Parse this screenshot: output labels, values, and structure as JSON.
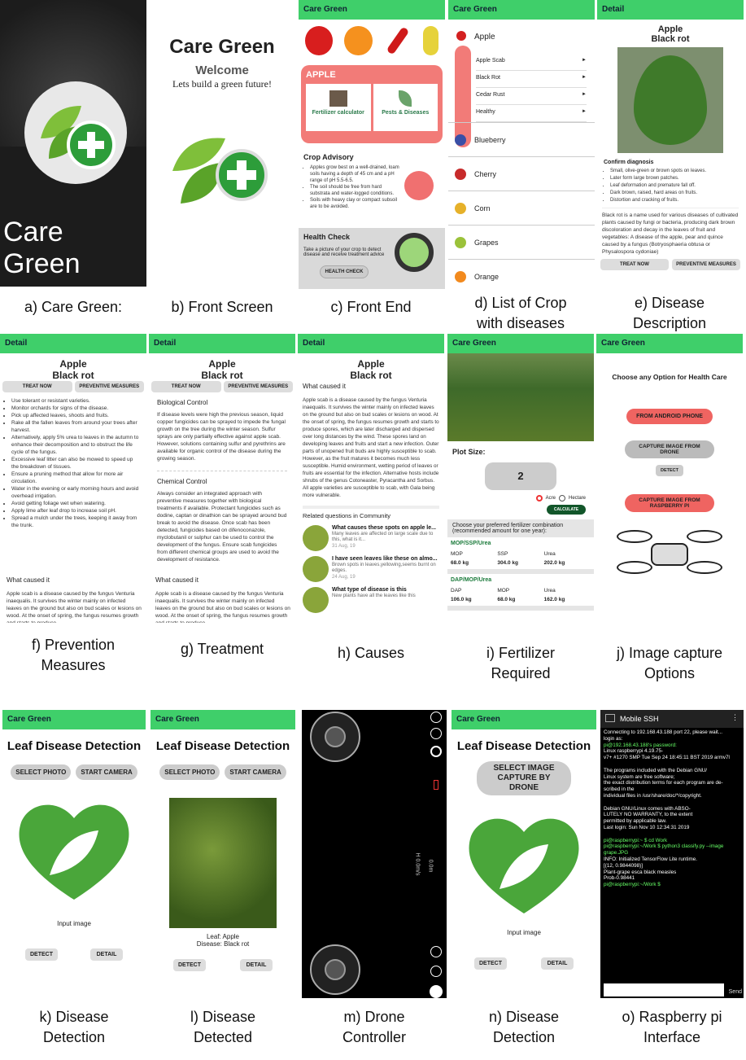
{
  "appname": "Care Green",
  "detail": "Detail",
  "splash": {
    "title": "Care Green"
  },
  "front": {
    "title": "Care Green",
    "welcome": "Welcome",
    "tagline": "Lets build a green future!"
  },
  "home": {
    "section": "APPLE",
    "fert": "Fertilizer calculator",
    "pests": "Pests & Diseases",
    "advisory_title": "Crop Advisory",
    "advisory": [
      "Apples grow best on a well-drained, loam soils having a depth of 45 cm and a pH range of pH 5.5-6.5.",
      "The soil should be free from hard substrata and water-logged conditions.",
      "Soils with heavy clay or compact subsoil are to be avoided."
    ],
    "health_title": "Health Check",
    "health_text": "Take a picture of your crop to detect disease and receive treatment advice",
    "health_btn": "HEALTH CHECK"
  },
  "croplist": {
    "apple": "Apple",
    "diseases": [
      "Apple Scab",
      "Black Rot",
      "Cedar Rust",
      "Healthy"
    ],
    "crops": [
      "Blueberry",
      "Cherry",
      "Corn",
      "Grapes",
      "Orange"
    ]
  },
  "disease": {
    "l1": "Apple",
    "l2": "Black rot",
    "confirm": "Confirm diagnosis",
    "symptoms": [
      "Small, olive-green or brown spots on leaves.",
      "Later form large brown patches.",
      "Leaf deformation and premature fall off.",
      "Dark brown, raised, hard areas on fruits.",
      "Distortion and cracking of fruits."
    ],
    "desc": "Black rot is a name used for various diseases of cultivated plants caused by fungi or bacteria, producing dark brown discoloration and decay in the leaves of fruit and vegetables: A disease of the apple, pear and quince caused by a fungus (Botryosphaeria obtusa or Physalospora cydoniae)",
    "treat": "TREAT NOW",
    "prev": "PREVENTIVE MEASURES"
  },
  "prevention": {
    "items": [
      "Use tolerant or resistant varieties.",
      "Monitor orchards for signs of the disease.",
      "Pick up affected leaves, shoots and fruits.",
      "Rake all the fallen leaves from around your trees after harvest.",
      "Alternatively, apply 5% urea to leaves in the autumn to enhance their decomposition and to obstruct the life cycle of the fungus.",
      "Excessive leaf litter can also be mowed to speed up the breakdown of tissues.",
      "Ensure a pruning method that allow for more air circulation.",
      "Water in the evening or early morning hours and avoid overhead irrigation.",
      "Avoid getting foliage wet when watering.",
      "Apply lime after leaf drop to increase soil pH.",
      "Spread a mulch under the trees, keeping it away from the trunk."
    ],
    "caused_title": "What caused it",
    "caused": "Apple scab is a disease caused by the fungus Venturia inaequalis. It survives the winter mainly on infected leaves on the ground but also on bud scales or lesions on wood. At the onset of spring, the fungus resumes growth and starts to produce"
  },
  "treatment": {
    "bio_title": "Biological Control",
    "bio": "If disease levels were high the previous season, liquid copper fungicides can be sprayed to impede the fungal growth on the tree during the winter season. Sulfur sprays are only partially effective against apple scab. However, solutions containing sulfur and pyrethrins are available for organic control of the disease during the growing season.",
    "chem_title": "Chemical Control",
    "chem": "Always consider an integrated approach with preventive measures together with biological treatments if available. Protectant fungicides such as dodine, captan or dinathion can be sprayed around bud break to avoid the disease. Once scab has been detected, fungicides based on difenoconazole, myclobutanil or sulphur can be used to control the development of the fungus. Ensure scab fungicides from different chemical groups are used to avoid the development of resistance."
  },
  "causes": {
    "text": "Apple scab is a disease caused by the fungus Venturia inaequalis. It survives the winter mainly on infected leaves on the ground but also on bud scales or lesions on wood. At the onset of spring, the fungus resumes growth and starts to produce spores, which are later discharged and dispersed over long distances by the wind. These spores land on developing leaves and fruits and start a new infection. Outer parts of unopened fruit buds are highly susceptible to scab. However, as the fruit matures it becomes much less susceptible. Humid environment, wetting period of leaves or fruits are essential for the infection. Alternative hosts include shrubs of the genus Cotoneaster, Pyracantha and Sorbus. All apple varieties are susceptible to scab, with Gala being more vulnerable.",
    "related": "Related questions in Community",
    "qs": [
      {
        "q": "What causes these spots on apple le...",
        "a": "Many leaves are affected on large scale due to this, what is it...",
        "d": "31 Aug, 19"
      },
      {
        "q": "I have seen leaves like these on almo...",
        "a": "Brown spots in leaves,yellowing,seems burnt on edges.",
        "d": "24 Aug, 19"
      },
      {
        "q": "What type of disease is this",
        "a": "New plants have all the leaves like this",
        "d": ""
      }
    ]
  },
  "fertilizer": {
    "plot": "Plot Size:",
    "value": "2",
    "acre": "Acre",
    "hectare": "Hectare",
    "calc": "CALCULATE",
    "choose": "Choose your preferred fertilizer combination (recommended amount for one year):",
    "combos": [
      {
        "name": "MOP/SSP/Urea",
        "h": [
          "MOP",
          "SSP",
          "Urea"
        ],
        "v": [
          "68.0 kg",
          "304.0 kg",
          "202.0 kg"
        ]
      },
      {
        "name": "DAP/MOP/Urea",
        "h": [
          "DAP",
          "MOP",
          "Urea"
        ],
        "v": [
          "106.0 kg",
          "68.0 kg",
          "162.0 kg"
        ]
      }
    ]
  },
  "capture": {
    "title": "Choose any Option for Health Care",
    "android": "FROM ANDROID PHONE",
    "drone": "CAPTURE IMAGE FROM DRONE",
    "detect": "DETECT",
    "rpi": "CAPTURE IMAGE FROM RASPBERRY PI"
  },
  "detection": {
    "title": "Leaf Disease Detection",
    "select": "SELECT PHOTO",
    "camera": "START CAMERA",
    "input": "Input image",
    "detect": "DETECT",
    "detail": "DETAIL",
    "leaf": "Leaf: Apple",
    "dis": "Disease: Black rot",
    "drone_btn": "SELECT IMAGE CAPTURE BY DRONE"
  },
  "drone": {
    "speed1": "H 0.0m/s",
    "speed2": "0.0m"
  },
  "ssh": {
    "title": "Mobile SSH",
    "lines": [
      "Connecting to 192.168.43.188 port 22, please wait...",
      "login as:",
      "pi@192.168.43.188's password:",
      "Linux raspberrypi 4.19.75-",
      "v7+ #1270 SMP Tue Sep 24 18:45:11 BST 2019 armv7l",
      "",
      "The programs included with the Debian GNU/",
      "Linux system are free software;",
      "the exact distribution terms for each program are de-",
      "scribed in the",
      "individual files in /usr/share/doc/*/copyright.",
      "",
      "Debian GNU/Linux comes with ABSO-",
      "LUTELY NO WARRANTY, to the extent",
      "permitted by applicable law.",
      "Last login: Sun Nov 10 12:34:31 2019",
      "",
      "pi@raspberrypi:~ $ cd Work",
      "pi@raspberrypi:~/Work $ python3 classify.py --image grape.JPG",
      "INFO: Initialized TensorFlow Lite runtime.",
      "[(12, 0.9844098)]",
      "Plant-grape esca black measles",
      "Prob-0.98441",
      "pi@raspberrypi:~/Work $"
    ],
    "send": "Send"
  },
  "captions": [
    [
      "a)",
      "Care Green:"
    ],
    [
      "b)",
      "Front Screen"
    ],
    [
      "c)",
      "Front End"
    ],
    [
      "d)",
      "List of Crop",
      "with diseases"
    ],
    [
      "e)",
      "Disease",
      "Description"
    ],
    [
      "f)",
      "Prevention",
      "Measures"
    ],
    [
      "g)",
      "Treatment"
    ],
    [
      "h)",
      "Causes"
    ],
    [
      "i)",
      "Fertilizer",
      "Required"
    ],
    [
      "j)",
      "Image capture",
      "Options"
    ],
    [
      "k)",
      "Disease",
      "Detection"
    ],
    [
      "l)",
      "Disease",
      "Detected"
    ],
    [
      "m)",
      "Drone",
      "Controller"
    ],
    [
      "n)",
      "Disease",
      "Detection"
    ],
    [
      "o)",
      "Raspberry pi",
      "Interface"
    ]
  ]
}
